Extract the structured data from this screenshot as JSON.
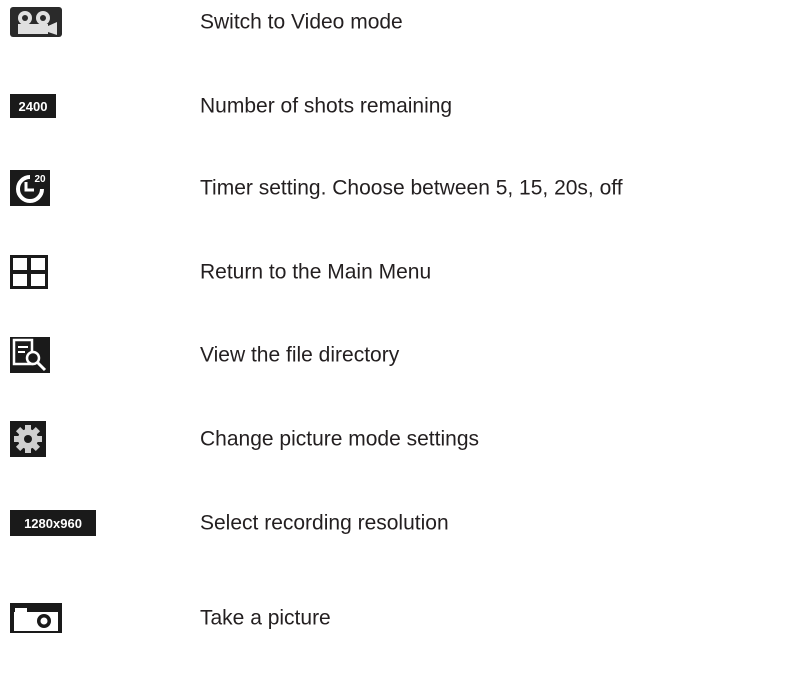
{
  "items": [
    {
      "icon": "video-camera-icon",
      "label": "Switch to Video mode"
    },
    {
      "icon": "shots-remaining-icon",
      "icon_text": "2400",
      "label": "Number of shots remaining"
    },
    {
      "icon": "timer-icon",
      "icon_text": "20",
      "label": "Timer setting. Choose between 5, 15, 20s, off"
    },
    {
      "icon": "main-menu-grid-icon",
      "label": "Return to the Main Menu"
    },
    {
      "icon": "file-directory-search-icon",
      "label": "View the file directory"
    },
    {
      "icon": "gear-icon",
      "label": "Change picture mode settings"
    },
    {
      "icon": "resolution-icon",
      "icon_text": "1280x960",
      "label": "Select recording resolution"
    },
    {
      "icon": "camera-icon",
      "label": "Take a picture"
    }
  ],
  "colors": {
    "icon_background": "#1a1a1a",
    "icon_foreground": "#ffffff",
    "text": "#231f20"
  }
}
